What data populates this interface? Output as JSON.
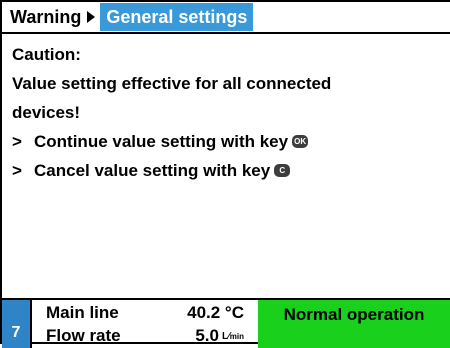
{
  "header": {
    "crumb_parent": "Warning",
    "crumb_current": "General settings"
  },
  "message": {
    "title": "Caution:",
    "line1": "Value setting effective for all connected",
    "line2": "devices!",
    "bullet_marker": ">",
    "continue_text": "Continue value setting with key",
    "continue_key": "OK",
    "cancel_text": "Cancel value setting with key",
    "cancel_key": "C"
  },
  "footer": {
    "device_number": "7",
    "main_line_label": "Main line",
    "main_line_value": "40.2 °C",
    "flow_rate_label": "Flow rate",
    "flow_rate_value": "5.0",
    "flow_rate_unit_top": "L",
    "flow_rate_unit_bottom": "min",
    "status": "Normal operation",
    "status_color": "#19d01c",
    "accent_color": "#3a9ad9"
  }
}
